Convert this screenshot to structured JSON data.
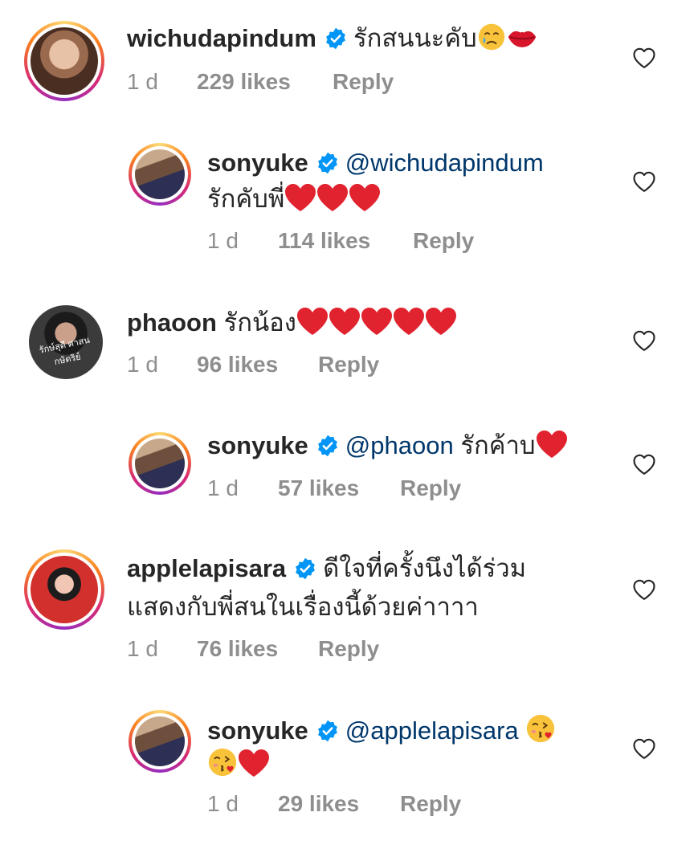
{
  "comments": [
    {
      "username": "wichudapindum",
      "verified": true,
      "text": "รักสนนะคับ",
      "emojis": [
        "crying-face",
        "kiss-mark"
      ],
      "time": "1 d",
      "likes": "229 likes",
      "reply": "Reply",
      "is_reply": false
    },
    {
      "username": "sonyuke",
      "verified": true,
      "mention": "@wichudapindum",
      "text": "รักคับพี่",
      "emojis": [
        "red-heart",
        "red-heart",
        "red-heart"
      ],
      "time": "1 d",
      "likes": "114 likes",
      "reply": "Reply",
      "is_reply": true
    },
    {
      "username": "phaoon",
      "verified": false,
      "text": "รักน้อง",
      "emojis": [
        "red-heart",
        "red-heart",
        "red-heart",
        "red-heart",
        "red-heart"
      ],
      "time": "1 d",
      "likes": "96 likes",
      "reply": "Reply",
      "is_reply": false,
      "avatar_caption": "รักษ์สุดี ศาสน กษัตริย์"
    },
    {
      "username": "sonyuke",
      "verified": true,
      "mention": "@phaoon",
      "text": "รักค้าบ",
      "emojis": [
        "red-heart"
      ],
      "time": "1 d",
      "likes": "57 likes",
      "reply": "Reply",
      "is_reply": true
    },
    {
      "username": "applelapisara",
      "verified": true,
      "text_line1": "ดีใจที่ครั้งนึงได้ร่วม",
      "text_line2": "แสดงกับพี่สนในเรื่องนี้ด้วยค่าาาา",
      "time": "1 d",
      "likes": "76 likes",
      "reply": "Reply",
      "is_reply": false
    },
    {
      "username": "sonyuke",
      "verified": true,
      "mention": "@applelapisara",
      "emojis": [
        "face-blowing-kiss",
        "face-blowing-kiss",
        "red-heart"
      ],
      "time": "1 d",
      "likes": "29 likes",
      "reply": "Reply",
      "is_reply": true
    }
  ],
  "colors": {
    "text": "#262626",
    "meta": "#8e8e8e",
    "mention": "#00376b",
    "verified": "#0095f6",
    "heart_emoji": "#e0232e"
  },
  "icons": {
    "verified": "verified-badge-icon",
    "like": "heart-outline-icon"
  }
}
